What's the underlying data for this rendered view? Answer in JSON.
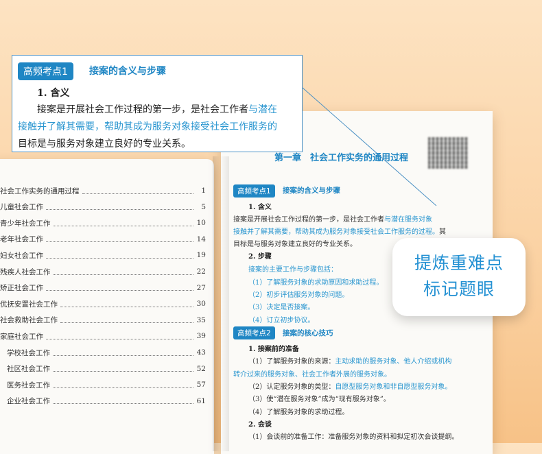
{
  "toc": [
    {
      "title": "社会工作实务的通用过程",
      "page": "1",
      "indent": false
    },
    {
      "title": "儿童社会工作",
      "page": "5",
      "indent": false
    },
    {
      "title": "青少年社会工作",
      "page": "10",
      "indent": false
    },
    {
      "title": "老年社会工作",
      "page": "14",
      "indent": false
    },
    {
      "title": "妇女社会工作",
      "page": "19",
      "indent": false
    },
    {
      "title": "残疾人社会工作",
      "page": "22",
      "indent": false
    },
    {
      "title": "矫正社会工作",
      "page": "27",
      "indent": false
    },
    {
      "title": "优抚安置社会工作",
      "page": "30",
      "indent": false
    },
    {
      "title": "社会救助社会工作",
      "page": "35",
      "indent": false
    },
    {
      "title": "家庭社会工作",
      "page": "39",
      "indent": false
    },
    {
      "title": "学校社会工作",
      "page": "43",
      "indent": true
    },
    {
      "title": "社区社会工作",
      "page": "52",
      "indent": true
    },
    {
      "title": "医务社会工作",
      "page": "57",
      "indent": true
    },
    {
      "title": "企业社会工作",
      "page": "61",
      "indent": true
    }
  ],
  "chapter": "第一章　社会工作实务的通用过程",
  "zoom": {
    "pill": "高频考点1",
    "title": "接案的含义与步骤",
    "item": "1. 含义",
    "line1_a": "接案是开展社会工作过程的第一步，是社会工作者",
    "line1_b": "与潜在",
    "line2": "接触并了解其需要，帮助其成为服务对象接受社会工作服务的",
    "line3": "目标是与服务对象建立良好的专业关系。"
  },
  "section1": {
    "pill": "高频考点1",
    "title": "接案的含义与步骤",
    "h1": "1. 含义",
    "p1a": "接案是开展社会工作过程的第一步，是社会工作者",
    "p1b": "与潜在服务对象",
    "p2": "接触并了解其需要，帮助其成为服务对象接受社会工作服务的过程。",
    "p2end": "其",
    "p3": "目标是与服务对象建立良好的专业关系。",
    "h2": "2. 步骤",
    "s0": "接案的主要工作与步骤包括：",
    "s1": "（1）了解服务对象的求助原因和求助过程。",
    "s2": "（2）初步评估服务对象的问题。",
    "s3": "（3）决定是否接案。",
    "s4": "（4）订立初步协议。"
  },
  "section2": {
    "pill": "高频考点2",
    "title": "接案的核心技巧",
    "h1": "1. 接案前的准备",
    "l1a": "（1）了解服务对象的来源：",
    "l1b": "主动求助的服务对象、他人介绍或机构",
    "l2": "转介过来的服务对象、社会工作者外展的服务对象。",
    "l3a": "（2）认定服务对象的类型：",
    "l3b": "自愿型服务对象和非自愿型服务对象。",
    "l4": "（3）使“潜在服务对象”成为“现有服务对象”。",
    "l5": "（4）了解服务对象的求助过程。",
    "h2": "2. 会谈",
    "l6": "（1）会谈前的准备工作：准备服务对象的资料和拟定初次会谈提纲。"
  },
  "badge": {
    "line1": "提炼重难点",
    "line2": "标记题眼"
  },
  "colors": {
    "accent": "#1f86c4",
    "highlight": "#2a96d0",
    "background": "#fbd3a5"
  }
}
